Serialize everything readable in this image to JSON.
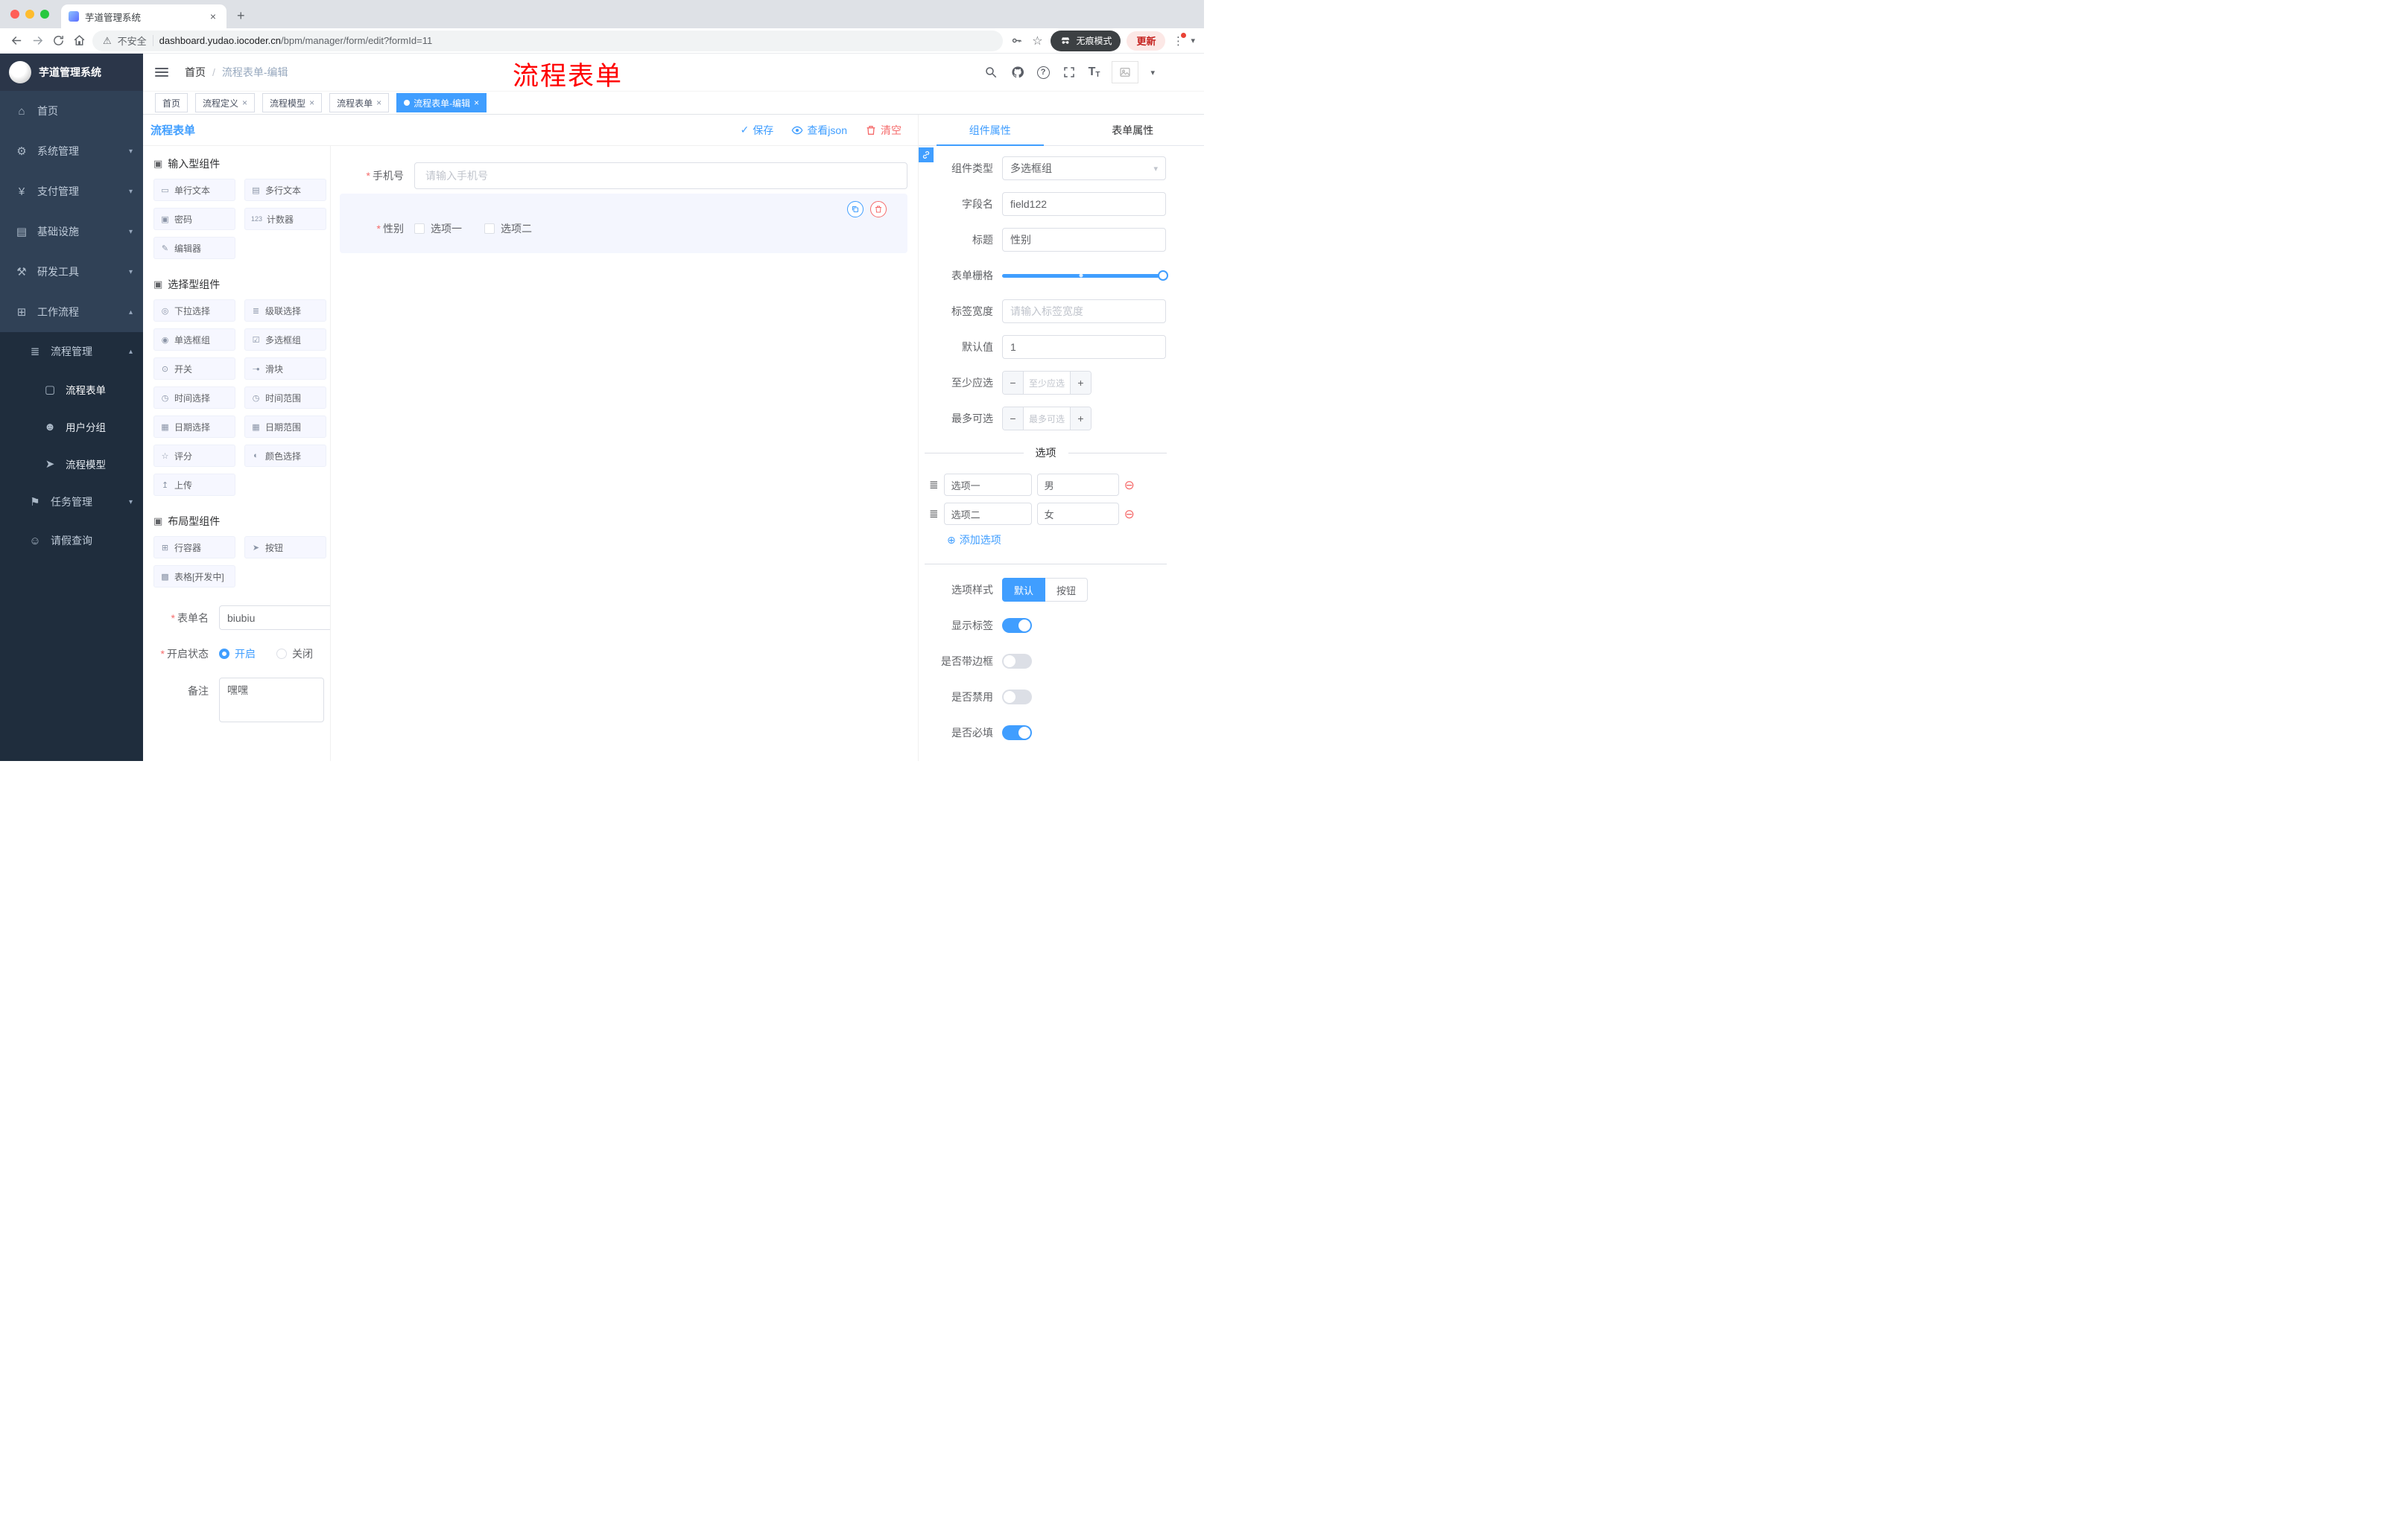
{
  "browser": {
    "tab_title": "芋道管理系统",
    "security_label": "不安全",
    "url_domain": "dashboard.yudao.iocoder.cn",
    "url_path": "/bpm/manager/form/edit?formId=11",
    "incognito_label": "无痕模式",
    "update_label": "更新"
  },
  "sidebar": {
    "app_title": "芋道管理系统",
    "menu": [
      {
        "label": "首页"
      },
      {
        "label": "系统管理"
      },
      {
        "label": "支付管理"
      },
      {
        "label": "基础设施"
      },
      {
        "label": "研发工具"
      },
      {
        "label": "工作流程"
      }
    ],
    "submenu_group": {
      "label": "流程管理"
    },
    "submenu_items": [
      {
        "label": "流程表单"
      },
      {
        "label": "用户分组"
      },
      {
        "label": "流程模型"
      }
    ],
    "submenu_siblings": [
      {
        "label": "任务管理"
      },
      {
        "label": "请假查询"
      }
    ]
  },
  "header": {
    "breadcrumb_home": "首页",
    "breadcrumb_sep": "/",
    "breadcrumb_current": "流程表单-编辑",
    "annotation": "流程表单"
  },
  "tags": [
    {
      "label": "首页"
    },
    {
      "label": "流程定义"
    },
    {
      "label": "流程模型"
    },
    {
      "label": "流程表单"
    },
    {
      "label": "流程表单-编辑"
    }
  ],
  "designer": {
    "panel_title": "流程表单",
    "toolbar": {
      "save": "保存",
      "view_json": "查看json",
      "clear": "清空"
    },
    "palette": {
      "groups": [
        {
          "title": "输入型组件",
          "items": [
            "单行文本",
            "多行文本",
            "密码",
            "计数器",
            "编辑器"
          ]
        },
        {
          "title": "选择型组件",
          "items": [
            "下拉选择",
            "级联选择",
            "单选框组",
            "多选框组",
            "开关",
            "滑块",
            "时间选择",
            "时间范围",
            "日期选择",
            "日期范围",
            "评分",
            "颜色选择",
            "上传"
          ]
        },
        {
          "title": "布局型组件",
          "items": [
            "行容器",
            "按钮",
            "表格[开发中]"
          ]
        }
      ]
    },
    "meta": {
      "form_name_label": "表单名",
      "form_name_value": "biubiu",
      "status_label": "开启状态",
      "status_on": "开启",
      "status_off": "关闭",
      "remark_label": "备注",
      "remark_value": "嘿嘿"
    },
    "canvas": {
      "phone_label": "手机号",
      "phone_placeholder": "请输入手机号",
      "gender_label": "性别",
      "gender_options": [
        "选项一",
        "选项二"
      ]
    }
  },
  "props": {
    "tabs": [
      "组件属性",
      "表单属性"
    ],
    "fields": {
      "component_type_label": "组件类型",
      "component_type_value": "多选框组",
      "field_name_label": "字段名",
      "field_name_value": "field122",
      "title_label": "标题",
      "title_value": "性别",
      "grid_label": "表单栅格",
      "label_width_label": "标签宽度",
      "label_width_placeholder": "请输入标签宽度",
      "default_label": "默认值",
      "default_value": "1",
      "min_label": "至少应选",
      "min_placeholder": "至少应选",
      "max_label": "最多可选",
      "max_placeholder": "最多可选"
    },
    "options_divider": "选项",
    "options": [
      {
        "label": "选项一",
        "value": "男"
      },
      {
        "label": "选项二",
        "value": "女"
      }
    ],
    "add_option": "添加选项",
    "style_label": "选项样式",
    "style_default": "默认",
    "style_button": "按钮",
    "toggles": [
      {
        "label": "显示标签",
        "on": true
      },
      {
        "label": "是否带边框",
        "on": false
      },
      {
        "label": "是否禁用",
        "on": false
      },
      {
        "label": "是否必填",
        "on": true
      }
    ],
    "accent_color": "#409eff",
    "danger_color": "#f56c6c"
  },
  "icons": {
    "question_mark": "?",
    "caret_down": "▾",
    "chevron_down": "▾",
    "chevron_up": "▴",
    "kebab": "⋮",
    "star": "☆",
    "warning": "⚠",
    "close": "×",
    "plus_tab": "+",
    "check": "✓",
    "add_circle": "⊕",
    "remove_circle": "⊖",
    "drag": "≣",
    "minus": "−",
    "plus": "+",
    "asterisk": "*",
    "menu_home": "⌂",
    "menu_system": "⚙",
    "menu_pay": "¥",
    "menu_infra": "▤",
    "menu_dev": "⚒",
    "menu_flow": "⊞",
    "menu_flow_mgmt": "≣",
    "menu_form": "▢",
    "menu_group": "☻",
    "menu_model": "➤",
    "menu_task": "⚑",
    "menu_leave": "☺",
    "group_box": "▣",
    "it_single": "▭",
    "it_multi": "▤",
    "it_password": "▣",
    "it_counter": "123",
    "it_editor": "✎",
    "it_select": "◎",
    "it_cascade": "≣",
    "it_radio": "◉",
    "it_checkbox": "☑",
    "it_switch": "⊙",
    "it_slider": "─●",
    "it_time": "◷",
    "it_timerange": "◷",
    "it_date": "▦",
    "it_daterange": "▦",
    "it_rate": "☆",
    "it_color": "◐",
    "it_upload": "↥",
    "it_row": "⊞",
    "it_button": "➤",
    "it_table": "▩",
    "font_large": "T",
    "font_small": "T"
  }
}
